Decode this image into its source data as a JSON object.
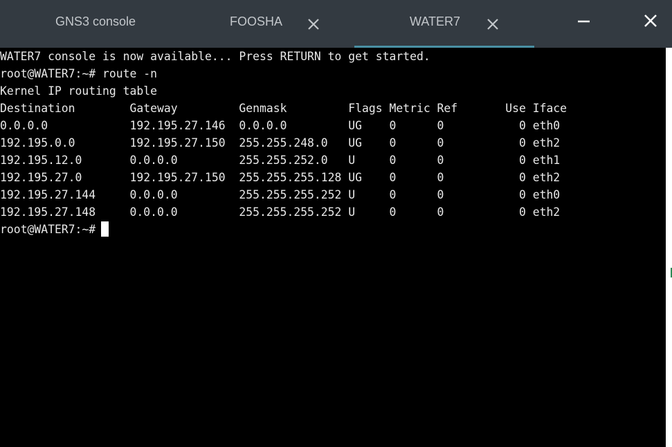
{
  "tabs": [
    {
      "label": "GNS3 console"
    },
    {
      "label": "FOOSHA"
    },
    {
      "label": "WATER7"
    }
  ],
  "active_tab": "WATER7",
  "window_controls": {
    "minimize_icon": "minimize-icon",
    "close_icon": "close-icon"
  },
  "terminal": {
    "lines": [
      "WATER7 console is now available... Press RETURN to get started.",
      "root@WATER7:~# route -n",
      "Kernel IP routing table"
    ],
    "routing_table": {
      "columns": [
        "Destination",
        "Gateway",
        "Genmask",
        "Flags",
        "Metric",
        "Ref",
        "Use",
        "Iface"
      ],
      "rows": [
        [
          "0.0.0.0",
          "192.195.27.146",
          "0.0.0.0",
          "UG",
          "0",
          "0",
          "0",
          "eth0"
        ],
        [
          "192.195.0.0",
          "192.195.27.150",
          "255.255.248.0",
          "UG",
          "0",
          "0",
          "0",
          "eth2"
        ],
        [
          "192.195.12.0",
          "0.0.0.0",
          "255.255.252.0",
          "U",
          "0",
          "0",
          "0",
          "eth1"
        ],
        [
          "192.195.27.0",
          "192.195.27.150",
          "255.255.255.128",
          "UG",
          "0",
          "0",
          "0",
          "eth2"
        ],
        [
          "192.195.27.144",
          "0.0.0.0",
          "255.255.255.252",
          "U",
          "0",
          "0",
          "0",
          "eth0"
        ],
        [
          "192.195.27.148",
          "0.0.0.0",
          "255.255.255.252",
          "U",
          "0",
          "0",
          "0",
          "eth2"
        ]
      ]
    },
    "prompt": "root@WATER7:~#"
  },
  "colors": {
    "titlebar": "#333a41",
    "tab_text": "#c3c7cb",
    "active_underline": "#4a90a4",
    "terminal_bg": "#000000",
    "terminal_fg": "#e8e8e8"
  }
}
